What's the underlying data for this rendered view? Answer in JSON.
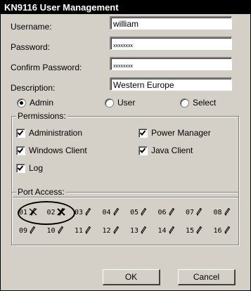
{
  "window": {
    "title": "KN9116 User Management"
  },
  "form": {
    "username_label": "Username:",
    "username_value": "william",
    "password_label": "Password:",
    "password_value": "xxxxxxxx",
    "confirm_label": "Confirm Password:",
    "confirm_value": "xxxxxxxx",
    "description_label": "Description:",
    "description_value": "Western Europe"
  },
  "roles": [
    {
      "label": "Admin",
      "selected": true
    },
    {
      "label": "User",
      "selected": false
    },
    {
      "label": "Select",
      "selected": false
    }
  ],
  "permissions": {
    "legend": "Permissions:",
    "items": [
      {
        "label": "Administration",
        "checked": true
      },
      {
        "label": "Power Manager",
        "checked": true
      },
      {
        "label": "Windows Client",
        "checked": true
      },
      {
        "label": "Java Client",
        "checked": true
      },
      {
        "label": "Log",
        "checked": true
      }
    ]
  },
  "port_access": {
    "legend": "Port Access:",
    "ports": [
      {
        "num": "01",
        "state": "crossed"
      },
      {
        "num": "02",
        "state": "blocked"
      },
      {
        "num": "03",
        "state": "edit"
      },
      {
        "num": "04",
        "state": "edit"
      },
      {
        "num": "05",
        "state": "edit"
      },
      {
        "num": "06",
        "state": "edit"
      },
      {
        "num": "07",
        "state": "edit"
      },
      {
        "num": "08",
        "state": "edit"
      },
      {
        "num": "09",
        "state": "edit"
      },
      {
        "num": "10",
        "state": "edit"
      },
      {
        "num": "11",
        "state": "edit"
      },
      {
        "num": "12",
        "state": "edit"
      },
      {
        "num": "13",
        "state": "edit"
      },
      {
        "num": "14",
        "state": "edit"
      },
      {
        "num": "15",
        "state": "edit"
      },
      {
        "num": "16",
        "state": "edit"
      }
    ]
  },
  "buttons": {
    "ok": "OK",
    "cancel": "Cancel"
  }
}
